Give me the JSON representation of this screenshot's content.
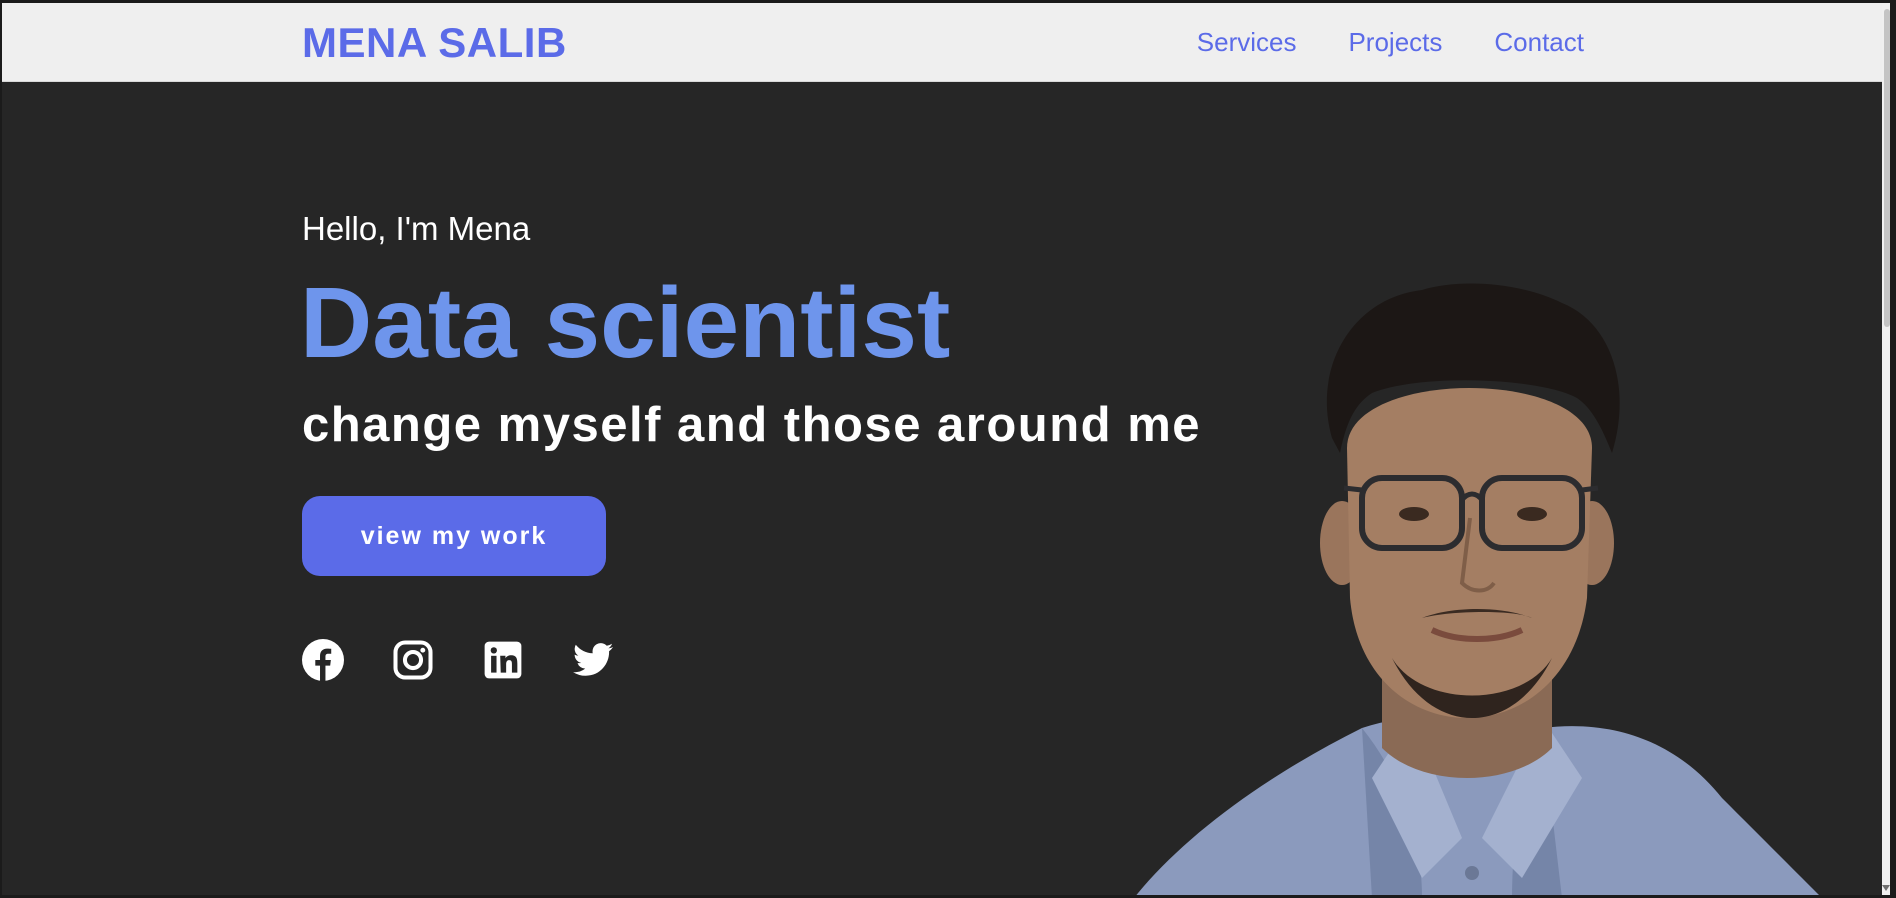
{
  "header": {
    "logo": "MENA SALIB",
    "nav": [
      {
        "label": "Services"
      },
      {
        "label": "Projects"
      },
      {
        "label": "Contact"
      }
    ]
  },
  "hero": {
    "greeting": "Hello, I'm Mena",
    "role": "Data scientist",
    "tagline": "change myself and those around me",
    "cta_label": "view my work",
    "socials": [
      {
        "icon": "facebook-icon"
      },
      {
        "icon": "instagram-icon"
      },
      {
        "icon": "linkedin-icon"
      },
      {
        "icon": "twitter-icon"
      }
    ]
  },
  "colors": {
    "accent": "#5b6be8",
    "role_text": "#6e95ec",
    "hero_bg": "#262626",
    "header_bg": "#efefef"
  }
}
